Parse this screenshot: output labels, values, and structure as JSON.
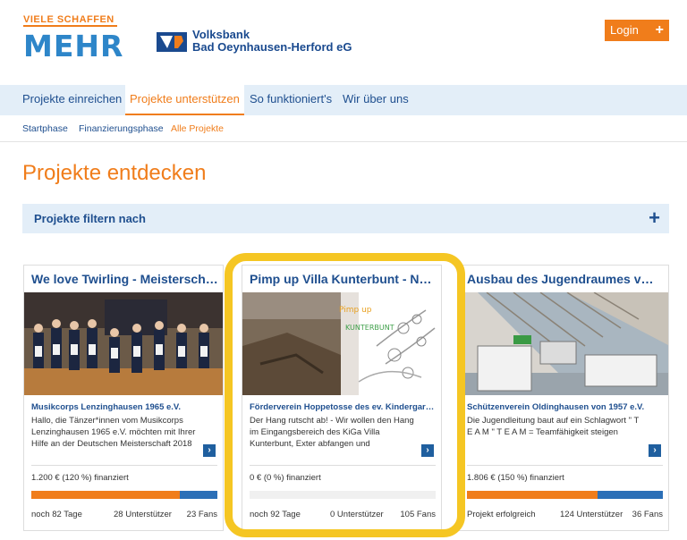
{
  "header": {
    "tagline": "VIELE SCHAFFEN",
    "logo_word": "MEHR",
    "bank_line1": "Volksbank",
    "bank_line2": "Bad Oeynhausen-Herford eG",
    "login_label": "Login",
    "login_plus": "+"
  },
  "mainnav": {
    "items": [
      {
        "label": "Projekte einreichen"
      },
      {
        "label": "Projekte unterstützen"
      },
      {
        "label": "So funktioniert's"
      },
      {
        "label": "Wir über uns"
      }
    ]
  },
  "subnav": {
    "items": [
      {
        "label": "Startphase"
      },
      {
        "label": "Finanzierungsphase"
      },
      {
        "label": "Alle Projekte"
      }
    ]
  },
  "page": {
    "title": "Projekte entdecken",
    "filter_label": "Projekte filtern nach",
    "filter_plus": "+"
  },
  "cards": [
    {
      "title": "We love Twirling - Meisterschaft…",
      "org": "Musikcorps Lenzinghausen 1965 e.V.",
      "desc": "Hallo, die Tänzer*innen vom Musikcorps Lenzinghausen 1965 e.V. möchten mit Ihrer Hilfe an der Deutschen Meisterschaft 2018",
      "funded": "1.200 € (120 %) finanziert",
      "progress_percent": 120,
      "days": "noch 82 Tage",
      "supporters": "28 Unterstützer",
      "fans": "23 Fans",
      "more": "›"
    },
    {
      "title": "Pimp up Villa Kunterbunt - NEU…",
      "org": "Förderverein Hoppetosse des ev. Kindergar…",
      "desc": "Der Hang rutscht ab! - Wir wollen den Hang im Eingangsbereich des KiGa Villa Kunterbunt, Exter abfangen und",
      "funded": "0 € (0 %) finanziert",
      "progress_percent": 0,
      "days": "noch 92 Tage",
      "supporters": "0 Unterstützer",
      "fans": "105 Fans",
      "more": "›",
      "image_caption": "Pimp up Villa KUNTERBUNT"
    },
    {
      "title": "Ausbau des Jugendraumes vom…",
      "org": "Schützenverein Oldinghausen von 1957 e.V.",
      "desc": "Die Jugendleitung baut auf ein Schlagwort \" T E A M \" T E A M = Teamfähigkeit steigen",
      "funded": "1.806 € (150 %) finanziert",
      "progress_percent": 150,
      "days": "Projekt erfolgreich",
      "supporters": "124 Unterstützer",
      "fans": "36 Fans",
      "more": "›"
    }
  ],
  "colors": {
    "orange": "#f07d1b",
    "blue": "#1f4f8f",
    "nav_bg": "#e3eef8",
    "highlight": "#f5c623"
  }
}
